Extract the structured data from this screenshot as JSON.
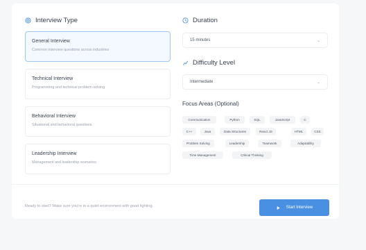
{
  "colors": {
    "accent": "#4a90e2",
    "selected_border": "#9ec6f3",
    "selected_bg": "#f4f9ff",
    "card_bg": "#ffffff",
    "page_bg": "#f6f7f9"
  },
  "interview_type": {
    "label": "Interview Type",
    "icon": "target-icon",
    "options": [
      {
        "title": "General Interview",
        "description": "Common interview questions across industries",
        "selected": true
      },
      {
        "title": "Technical Interview",
        "description": "Programming and technical problem-solving",
        "selected": false
      },
      {
        "title": "Behavioral Interview",
        "description": "Situational and behavioral questions",
        "selected": false
      },
      {
        "title": "Leadership Interview",
        "description": "Management and leadership scenarios",
        "selected": false
      }
    ]
  },
  "duration": {
    "label": "Duration",
    "icon": "clock-icon",
    "value": "15 minutes"
  },
  "difficulty": {
    "label": "Difficulty Level",
    "icon": "chart-icon",
    "value": "Intermediate"
  },
  "focus_areas": {
    "label": "Focus Areas (Optional)",
    "tags": [
      "Communication",
      "Python",
      "SQL",
      "JavaScript",
      "C",
      "C++",
      "Java",
      "Data Structures",
      "React JS",
      "HTML",
      "CSS",
      "Problem Solving",
      "Leadership",
      "Teamwork",
      "Adaptability",
      "Time Management",
      "Critical Thinking"
    ]
  },
  "footer": {
    "hint": "Ready to start? Make sure you're in a quiet environment with good lighting.",
    "start_button": "Start Interview",
    "start_icon": "play-icon"
  }
}
